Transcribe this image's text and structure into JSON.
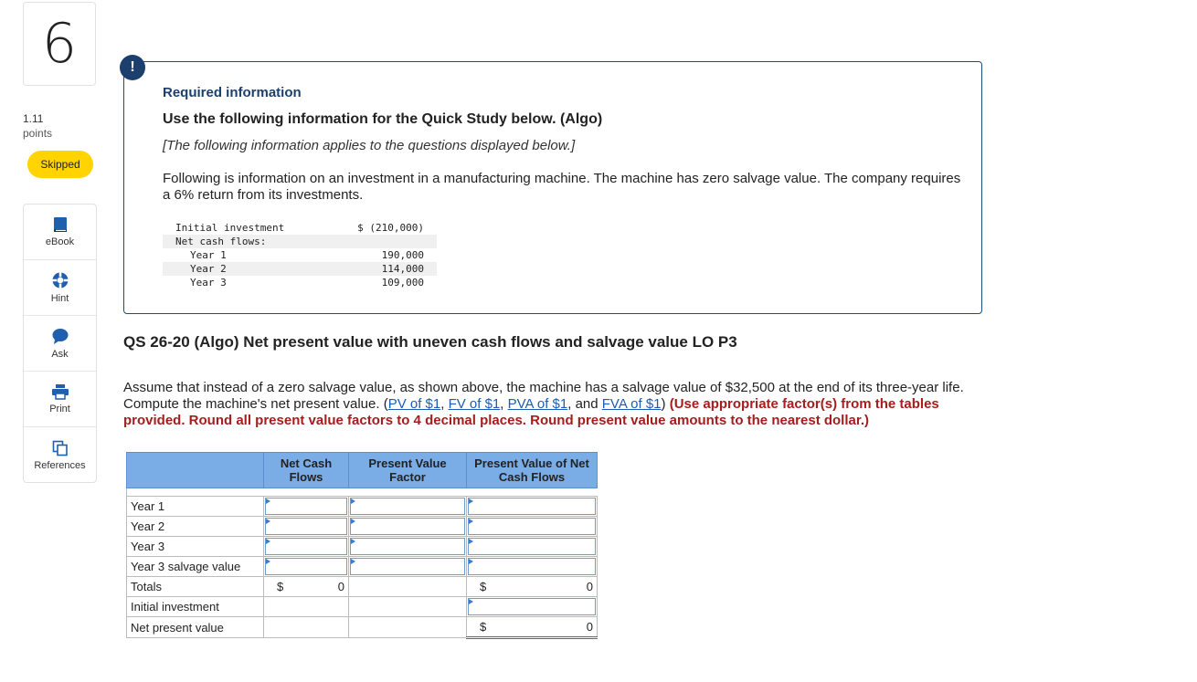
{
  "question": {
    "number": "6",
    "points_value": "1.11",
    "points_label": "points",
    "status": "Skipped"
  },
  "tools": [
    {
      "label": "eBook",
      "icon": "book-icon"
    },
    {
      "label": "Hint",
      "icon": "lifebuoy-icon"
    },
    {
      "label": "Ask",
      "icon": "chat-bubble-icon"
    },
    {
      "label": "Print",
      "icon": "printer-icon"
    },
    {
      "label": "References",
      "icon": "copy-icon"
    }
  ],
  "info": {
    "badge": "!",
    "title": "Required information",
    "subtitle": "Use the following information for the Quick Study below. (Algo)",
    "applies": "[The following information applies to the questions displayed below.]",
    "description": "Following is information on an investment in a manufacturing machine. The machine has zero salvage value. The company requires a 6% return from its investments.",
    "table": [
      {
        "label": "Initial investment",
        "value": "$ (210,000)",
        "indent": false
      },
      {
        "label": "Net cash flows:",
        "value": "",
        "indent": false
      },
      {
        "label": "Year 1",
        "value": "190,000",
        "indent": true
      },
      {
        "label": "Year 2",
        "value": "114,000",
        "indent": true
      },
      {
        "label": "Year 3",
        "value": "109,000",
        "indent": true
      }
    ]
  },
  "qs": {
    "title": "QS 26-20 (Algo) Net present value with uneven cash flows and salvage value LO P3",
    "text_before": "Assume that instead of a zero salvage value, as shown above, the machine has a salvage value of $32,500 at the end of its three-year life. Compute the machine's net present value. (",
    "links": [
      "PV of $1",
      "FV of $1",
      "PVA of $1",
      "FVA of $1"
    ],
    "sep1": ", ",
    "sep2": ", ",
    "sep3": ", and ",
    "text_after": ") ",
    "instruction": "(Use appropriate factor(s) from the tables provided. Round all present value factors to 4 decimal places. Round present value amounts to the nearest dollar.)"
  },
  "answer_table": {
    "headers": [
      "Net Cash Flows",
      "Present Value Factor",
      "Present Value of Net Cash Flows"
    ],
    "rows": [
      "Year 1",
      "Year 2",
      "Year 3",
      "Year 3 salvage value",
      "Totals",
      "Initial investment",
      "Net present value"
    ],
    "currency": "$",
    "totals_cash_flows": "0",
    "totals_pv": "0",
    "npv_value": "0"
  }
}
